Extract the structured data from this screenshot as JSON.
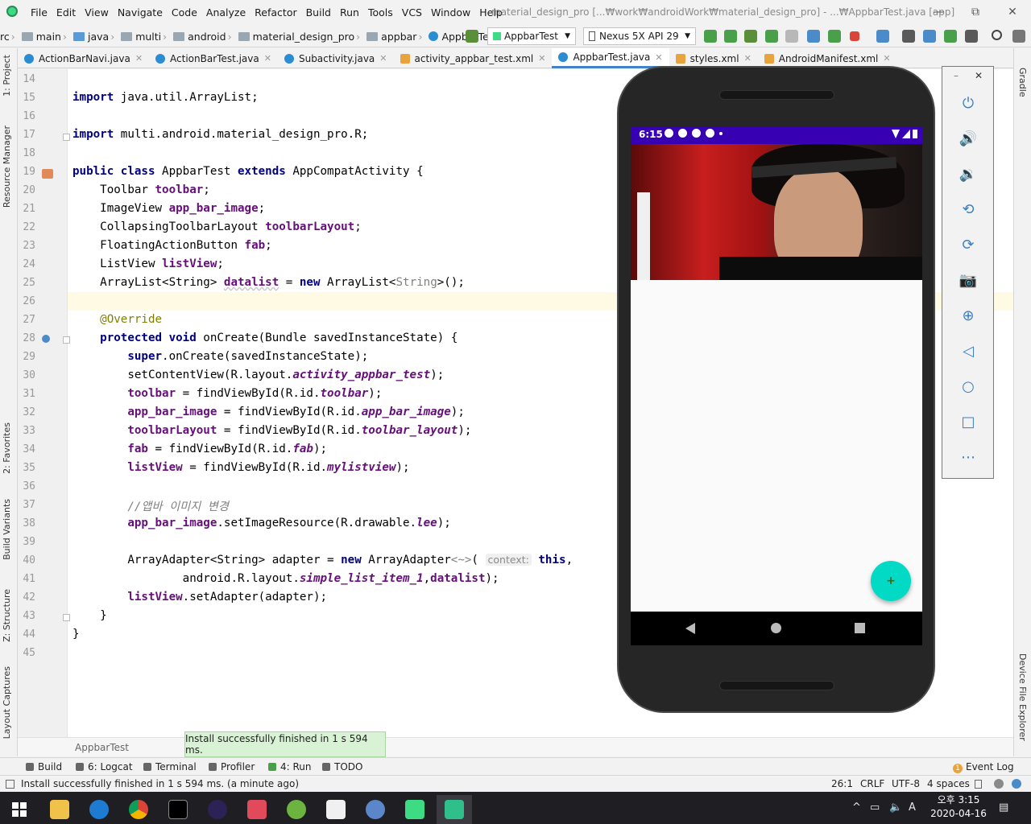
{
  "menubar": {
    "items": [
      "File",
      "Edit",
      "View",
      "Navigate",
      "Code",
      "Analyze",
      "Refactor",
      "Build",
      "Run",
      "Tools",
      "VCS",
      "Window",
      "Help"
    ],
    "window_title": "material_design_pro [...₩work₩androidWork₩material_design_pro] - ...₩AppbarTest.java [app]",
    "min": "—",
    "max": "⧉",
    "close": "✕"
  },
  "breadcrumb": {
    "items": [
      "rc",
      "main",
      "java",
      "multi",
      "android",
      "material_design_pro",
      "appbar",
      "AppbarTest"
    ]
  },
  "toolbar": {
    "run_config": "AppbarTest",
    "device": "Nexus 5X API 29"
  },
  "tabs": [
    {
      "label": "ActionBarNavi.java",
      "type": "java"
    },
    {
      "label": "ActionBarTest.java",
      "type": "java"
    },
    {
      "label": "Subactivity.java",
      "type": "java"
    },
    {
      "label": "activity_appbar_test.xml",
      "type": "xml"
    },
    {
      "label": "AppbarTest.java",
      "type": "java",
      "active": true
    },
    {
      "label": "styles.xml",
      "type": "xml"
    },
    {
      "label": "AndroidManifest.xml",
      "type": "xml"
    }
  ],
  "left_strip": [
    "1: Project",
    "Resource Manager",
    "2: Favorites",
    "Build Variants",
    "Z: Structure",
    "Layout Captures"
  ],
  "right_strip": [
    "Gradle",
    "Device File Explorer"
  ],
  "editor": {
    "line_numbers": [
      "14",
      "15",
      "16",
      "17",
      "18",
      "19",
      "20",
      "21",
      "22",
      "23",
      "24",
      "25",
      "26",
      "27",
      "28",
      "29",
      "30",
      "31",
      "32",
      "33",
      "34",
      "35",
      "36",
      "37",
      "38",
      "39",
      "40",
      "41",
      "42",
      "43",
      "44",
      "45"
    ],
    "code": {
      "l15_kw": "import",
      "l15": " java.util.ArrayList;",
      "l17_kw": "import",
      "l17": " multi.android.material_design_pro.R;",
      "l19_kw1": "public class",
      "l19_a": " AppbarTest ",
      "l19_kw2": "extends",
      "l19_b": " AppCompatActivity {",
      "l20_a": "    Toolbar ",
      "l20_f": "toolbar",
      "l20_b": ";",
      "l21_a": "    ImageView ",
      "l21_f": "app_bar_image",
      "l21_b": ";",
      "l22_a": "    CollapsingToolbarLayout ",
      "l22_f": "toolbarLayout",
      "l22_b": ";",
      "l23_a": "    FloatingActionButton ",
      "l23_f": "fab",
      "l23_b": ";",
      "l24_a": "    ListView ",
      "l24_f": "listView",
      "l24_b": ";",
      "l25_a": "    ArrayList<String> ",
      "l25_f": "datalist",
      "l25_b": " = ",
      "l25_kw": "new",
      "l25_c": " ArrayList<",
      "l25_g": "String",
      "l25_d": ">();",
      "l27_ann": "    @Override",
      "l28_kw": "    protected void",
      "l28_a": " onCreate(Bundle savedInstanceState) {",
      "l29_kw": "        super",
      "l29_a": ".onCreate(savedInstanceState);",
      "l30_a": "        setContentView(R.layout.",
      "l30_f": "activity_appbar_test",
      "l30_b": ");",
      "l31_f1": "        toolbar",
      "l31_a": " = findViewById(R.id.",
      "l31_f2": "toolbar",
      "l31_b": ");",
      "l32_f1": "        app_bar_image",
      "l32_a": " = findViewById(R.id.",
      "l32_f2": "app_bar_image",
      "l32_b": ");",
      "l33_f1": "        toolbarLayout",
      "l33_a": " = findViewById(R.id.",
      "l33_f2": "toolbar_layout",
      "l33_b": ");",
      "l34_f1": "        fab",
      "l34_a": " = findViewById(R.id.",
      "l34_f2": "fab",
      "l34_b": ");",
      "l35_f1": "        listView",
      "l35_a": " = findViewById(R.id.",
      "l35_f2": "mylistview",
      "l35_b": ");",
      "l37_cmt": "        //앱바 이미지 변경",
      "l38_f1": "        app_bar_image",
      "l38_a": ".setImageResource(R.drawable.",
      "l38_f2": "lee",
      "l38_b": ");",
      "l40_a": "        ArrayAdapter<String> adapter = ",
      "l40_kw": "new",
      "l40_b": " ArrayAdapter",
      "l40_g": "<~>",
      "l40_c": "( ",
      "l40_hint": "context:",
      "l40_kw2": " this",
      "l40_d": ",",
      "l41_a": "                android.R.layout.",
      "l41_f1": "simple_list_item_1",
      "l41_b": ",",
      "l41_f2": "datalist",
      "l41_c": ");",
      "l42_f": "        listView",
      "l42_a": ".setAdapter(adapter);",
      "l43": "    }",
      "l44": "}"
    },
    "bottom_crumb": "AppbarTest"
  },
  "toast": "Install successfully finished in 1 s 594 ms.",
  "bottom_tools": {
    "build": "Build",
    "logcat": "6: Logcat",
    "terminal": "Terminal",
    "profiler": "Profiler",
    "run": "4: Run",
    "todo": "TODO",
    "event_log": "Event Log",
    "event_count": "1"
  },
  "status": {
    "message": "Install successfully finished in 1 s 594 ms. (a minute ago)",
    "position": "26:1",
    "line_sep": "CRLF",
    "encoding": "UTF-8",
    "indent": "4 spaces"
  },
  "emulator": {
    "time": "6:15",
    "fab_icon": "+",
    "accent": "#03dac5",
    "statusbar_color": "#3700b3"
  },
  "taskbar": {
    "time": "오후 3:15",
    "date": "2020-04-16",
    "ime": "A"
  }
}
